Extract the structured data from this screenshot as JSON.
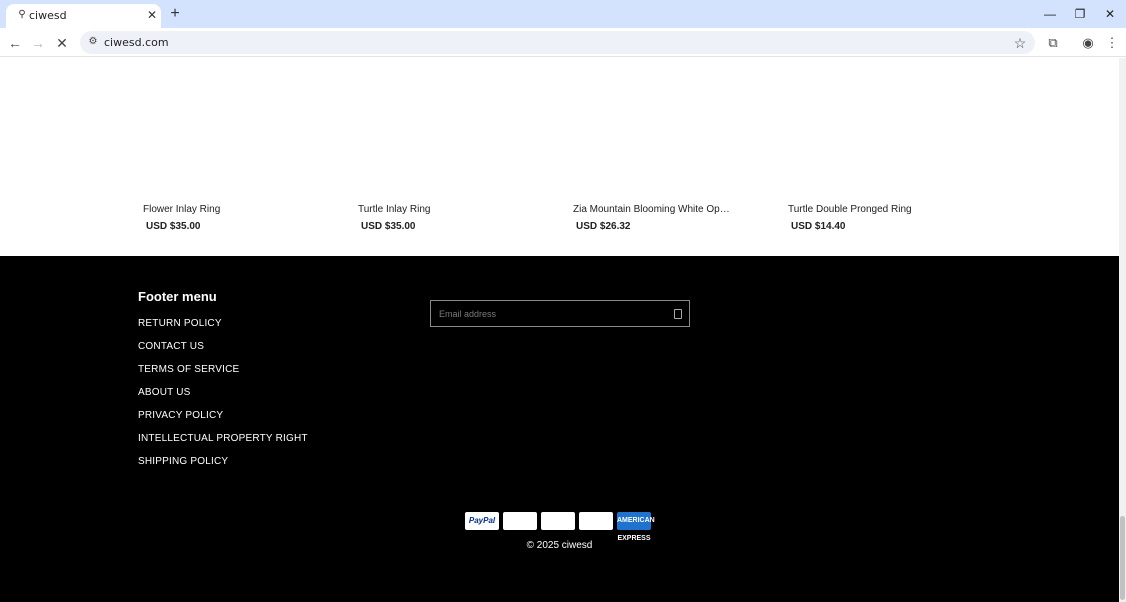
{
  "browser": {
    "tab_title": "ciwesd",
    "url": "ciwesd.com"
  },
  "products": [
    {
      "name": "Flower Inlay Ring",
      "price": "USD $35.00"
    },
    {
      "name": "Turtle Inlay Ring",
      "price": "USD $35.00"
    },
    {
      "name": "Zia Mountain Blooming White Opal &...",
      "price": "USD $26.32"
    },
    {
      "name": "Turtle Double Pronged Ring",
      "price": "USD $14.40"
    }
  ],
  "footer": {
    "heading": "Footer menu",
    "links": [
      "RETURN POLICY",
      "CONTACT US",
      "TERMS OF SERVICE",
      "ABOUT US",
      "PRIVACY POLICY",
      "INTELLECTUAL PROPERTY RIGHT",
      "SHIPPING POLICY"
    ],
    "email_placeholder": "Email address",
    "payment_icons": [
      "PayPal",
      "",
      "",
      "",
      "AMERICAN EXPRESS"
    ],
    "copyright": "© 2025 ciwesd"
  },
  "colors": {
    "tab_strip": "#d3e3fd",
    "footer_bg": "#000000",
    "amex": "#1f72cd"
  }
}
